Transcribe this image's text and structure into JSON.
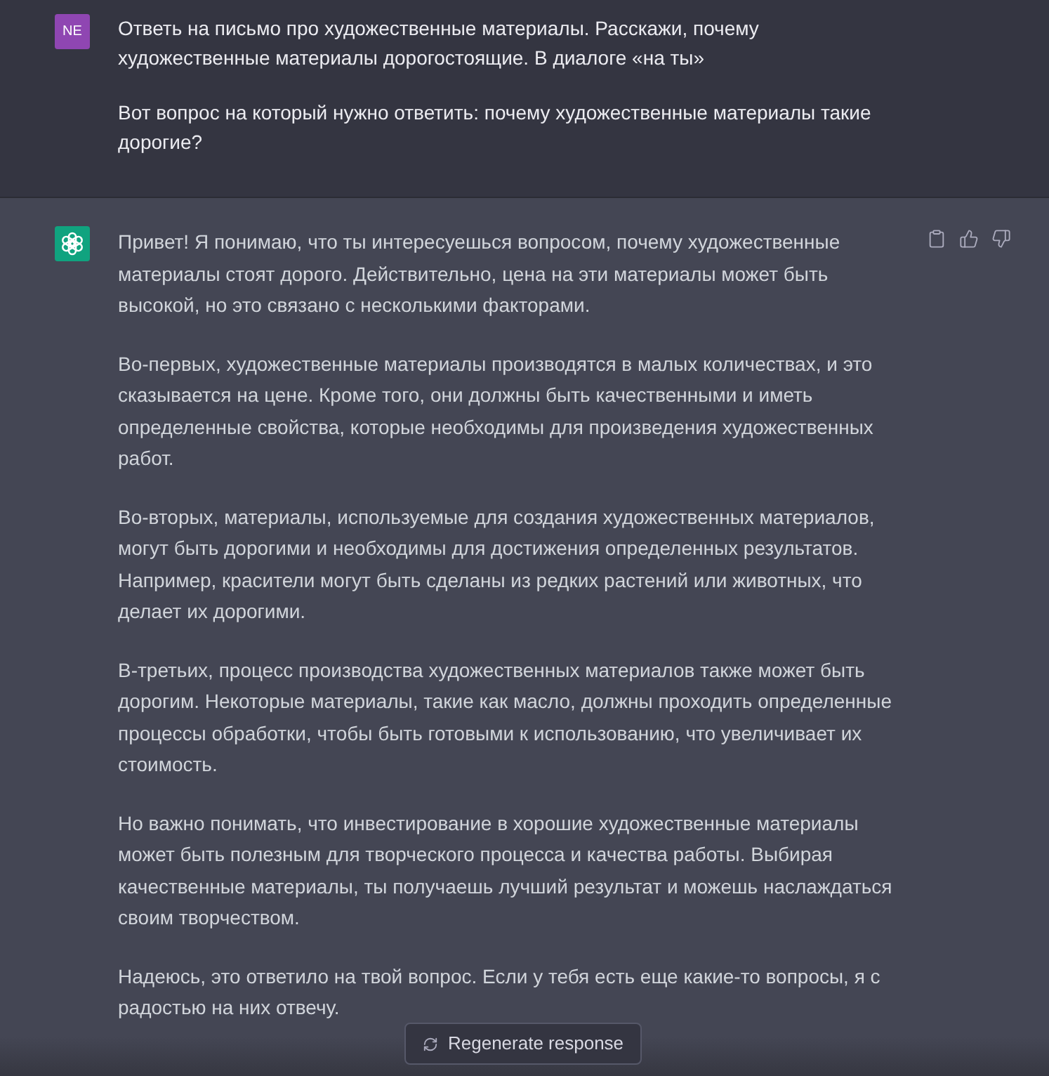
{
  "messages": [
    {
      "kind": "user",
      "avatar": "NE",
      "paragraphs": [
        "Ответь на письмо про художественные материалы. Расскажи, почему художественные материалы дорогостоящие. В диалоге «на ты»",
        "Вот вопрос на который нужно ответить: почему художественные материалы такие дорогие?"
      ]
    },
    {
      "kind": "assistant",
      "paragraphs": [
        "Привет! Я понимаю, что ты интересуешься вопросом, почему художественные материалы стоят дорого. Действительно, цена на эти материалы может быть высокой, но это связано с несколькими факторами.",
        "Во-первых, художественные материалы производятся в малых количествах, и это сказывается на цене. Кроме того, они должны быть качественными и иметь определенные свойства, которые необходимы для произведения художественных работ.",
        "Во-вторых, материалы, используемые для создания художественных материалов, могут быть дорогими и необходимы для достижения определенных результатов. Например, красители могут быть сделаны из редких растений или животных, что делает их дорогими.",
        "В-третьих, процесс производства художественных материалов также может быть дорогим. Некоторые материалы, такие как масло, должны проходить определенные процессы обработки, чтобы быть готовыми к использованию, что увеличивает их стоимость.",
        "Но важно понимать, что инвестирование в хорошие художественные материалы может быть полезным для творческого процесса и качества работы. Выбирая качественные материалы, ты получаешь лучший результат и можешь наслаждаться своим творчеством.",
        "Надеюсь, это ответило на твой вопрос. Если у тебя есть еще какие-то вопросы, я с радостью на них отвечу."
      ]
    }
  ],
  "regenerate_button": {
    "label": "Regenerate response"
  }
}
